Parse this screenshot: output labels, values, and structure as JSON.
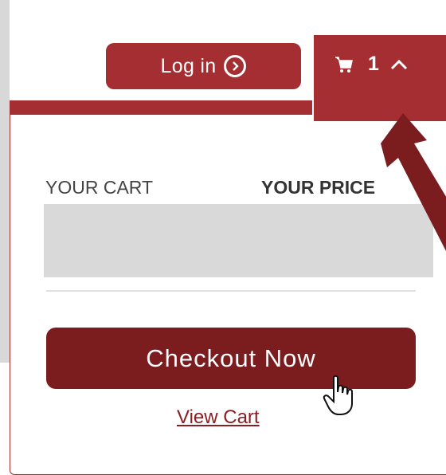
{
  "header": {
    "login_label": "Log in",
    "login_icon": "chevron-right-circle-icon",
    "cart_icon": "shopping-cart-icon",
    "cart_count": "1",
    "cart_toggle_icon": "chevron-up-icon"
  },
  "cart_panel": {
    "column_cart": "YOUR CART",
    "column_price": "YOUR PRICE",
    "checkout_label": "Checkout Now",
    "view_cart_label": "View Cart"
  },
  "overlay": {
    "pointer_icon": "hand-pointer-icon",
    "annotation_icon": "arrow-annotation-icon"
  },
  "colors": {
    "brand": "#a42e31",
    "checkout": "#7b1c1f",
    "background_grey": "#d8d8d8"
  }
}
